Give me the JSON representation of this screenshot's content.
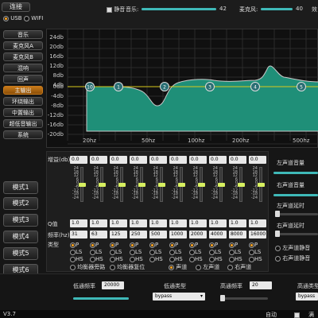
{
  "header": {
    "connect_label": "连接",
    "conn_usb": "USB",
    "conn_wifi": "WIFI",
    "mute_label": "静音",
    "music_label": "音乐:",
    "music_value": "42",
    "mic_label": "麦克风:",
    "mic_value": "40",
    "effect_label": "效"
  },
  "sidebar": {
    "items": [
      "音乐",
      "麦克风A",
      "麦克风B",
      "混响",
      "回声",
      "主输出",
      "环绕输出",
      "中置输出",
      "超低音输出",
      "系统"
    ],
    "modes": [
      "模式1",
      "模式2",
      "模式3",
      "模式4",
      "模式5",
      "模式6"
    ]
  },
  "eq_graph": {
    "y_labels": [
      "24db",
      "20db",
      "16db",
      "12db",
      "8db",
      "4db",
      "0db",
      "-4db",
      "-8db",
      "-12db",
      "-16db",
      "-20db",
      "-24db"
    ],
    "x_labels": [
      "20hz",
      "50hz",
      "100hz",
      "200hz",
      "500hz"
    ],
    "nodes": [
      "10",
      "1",
      "2",
      "3",
      "4",
      "5"
    ],
    "colors": {
      "fill": "#1f8f78",
      "line": "#c8c8c8",
      "zero": "#d8c81c",
      "grid": "#2a2a2a"
    }
  },
  "bands": {
    "gain_label": "增益(db)",
    "gains": [
      "0.0",
      "0.0",
      "0.0",
      "0.0",
      "0.0",
      "0.0",
      "0.0",
      "0.0",
      "0.0",
      "0.0"
    ],
    "scale": [
      "24",
      "18",
      "12",
      "6",
      "0",
      "-6",
      "-12",
      "-18",
      "-24"
    ],
    "q_label": "Q值",
    "qs": [
      "1.0",
      "1.0",
      "1.0",
      "1.0",
      "1.0",
      "1.0",
      "1.0",
      "1.0",
      "1.0",
      "1.0"
    ],
    "freq_label": "频率(hz)",
    "freqs": [
      "31",
      "63",
      "125",
      "250",
      "500",
      "1000",
      "2000",
      "4000",
      "8000",
      "16000"
    ],
    "type_label": "类型",
    "type_opts": [
      "P",
      "LS",
      "HS"
    ],
    "eq_reset": "均衡器旁路",
    "eq_default": "均衡器复位",
    "ch_stereo": "声道",
    "ch_left": "左声道",
    "ch_right": "右声道"
  },
  "right_panel": {
    "left_vol": "左声道音量",
    "right_vol": "右声道音量",
    "left_delay": "左声道延时",
    "right_delay": "右声道延时",
    "left_mute": "左声道静音",
    "right_mute": "右声道静音"
  },
  "filters": {
    "lowpass_freq_label": "低通频率",
    "lowpass_freq": "20000",
    "lowpass_type_label": "低通类型",
    "lowpass_type": "bypass",
    "highpass_freq_label": "高通频率",
    "highpass_freq": "20",
    "highpass_type_label": "高通类型",
    "highpass_type": "bypass"
  },
  "status": {
    "version": "V3.7",
    "auto_label": "自动",
    "ext_label": "满"
  }
}
